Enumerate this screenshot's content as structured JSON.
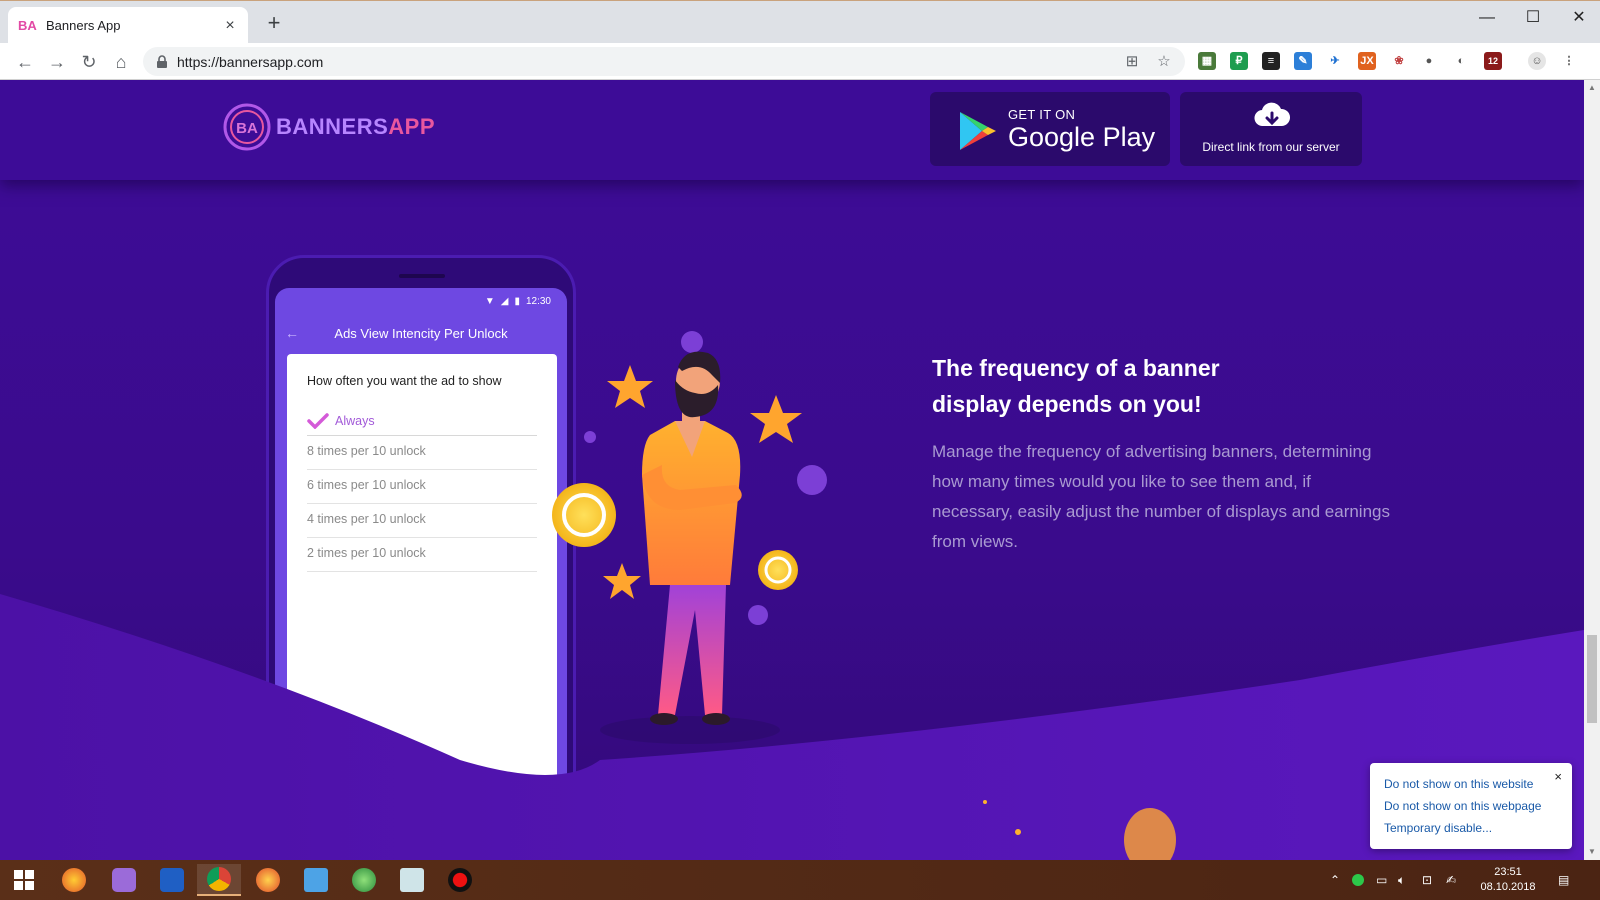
{
  "browser": {
    "tab_title": "Banners App",
    "tab_favicon": "BA",
    "url": "https://bannersapp.com",
    "new_tab_label": "+",
    "extension_badge": "12"
  },
  "header": {
    "logo_mark": "BA",
    "logo_text_1": "BANNERS",
    "logo_text_2": "APP",
    "google_play_small": "GET IT ON",
    "google_play_big": "Google Play",
    "direct_link_label": "Direct link from our server"
  },
  "phone": {
    "status_time": "12:30",
    "appbar_title": "Ads View Intencity Per Unlock",
    "card_title": "How often you want the ad to show",
    "selected_option": "Always",
    "options": [
      "8 times per 10 unlock",
      "6 times per 10 unlock",
      "4 times per 10 unlock",
      "2 times per 10 unlock"
    ]
  },
  "content": {
    "heading_line1": "The frequency of a banner",
    "heading_line2": "display depends on you!",
    "body": "Manage the frequency of advertising banners, determining how many times would you like to see them and, if necessary, easily adjust the number of displays and earnings from views."
  },
  "popup": {
    "close_label": "×",
    "items": [
      "Do not show on this website",
      "Do not show on this webpage",
      "Temporary disable..."
    ]
  },
  "taskbar": {
    "time": "23:51",
    "date": "08.10.2018"
  },
  "colors": {
    "page_bg": "#3d0c97",
    "accent_pink": "#e8579f",
    "accent_purple": "#b785ff",
    "body_text": "#a99ad1"
  }
}
